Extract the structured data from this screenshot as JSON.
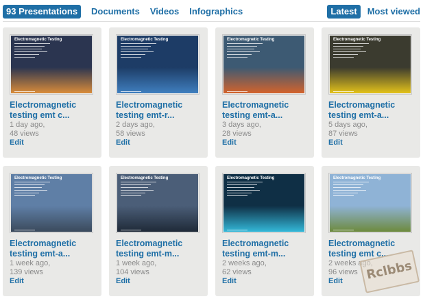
{
  "tabs": {
    "presentations_label": "93 Presentations",
    "documents_label": "Documents",
    "videos_label": "Videos",
    "infographics_label": "Infographics"
  },
  "sort": {
    "latest_label": "Latest",
    "most_viewed_label": "Most viewed"
  },
  "cards": [
    {
      "title_line1": "Electromagnetic",
      "title_line2": "testing emt c...",
      "age": "1 day ago,",
      "views": "48 views",
      "edit": "Edit",
      "thumb_title": "Electromagnetic Testing",
      "bg": "#2b3550",
      "accent": "#d98c3a"
    },
    {
      "title_line1": "Electromagnetic",
      "title_line2": "testing emt-r...",
      "age": "2 days ago,",
      "views": "58 views",
      "edit": "Edit",
      "thumb_title": "Electromagnetic Testing",
      "bg": "#1d3c66",
      "accent": "#3f7fbf"
    },
    {
      "title_line1": "Electromagnetic",
      "title_line2": "testing emt-a...",
      "age": "3 days ago,",
      "views": "28 views",
      "edit": "Edit",
      "thumb_title": "Electromagnetic Testing",
      "bg": "#3d5a73",
      "accent": "#d3632c"
    },
    {
      "title_line1": "Electromagnetic",
      "title_line2": "testing emt-a...",
      "age": "5 days ago,",
      "views": "87 views",
      "edit": "Edit",
      "thumb_title": "Electromagnetic Testing",
      "bg": "#3b3b2f",
      "accent": "#e3c21a"
    },
    {
      "title_line1": "Electromagnetic",
      "title_line2": "testing emt-a...",
      "age": "1 week ago,",
      "views": "139 views",
      "edit": "Edit",
      "thumb_title": "Electromagnetic Testing",
      "bg": "#5f7fa6",
      "accent": "#3b4a5c"
    },
    {
      "title_line1": "Electromagnetic",
      "title_line2": "testing emt-m...",
      "age": "1 week ago,",
      "views": "104 views",
      "edit": "Edit",
      "thumb_title": "Electromagnetic Testing",
      "bg": "#4b5e78",
      "accent": "#1f2a38"
    },
    {
      "title_line1": "Electromagnetic",
      "title_line2": "testing emt-m...",
      "age": "2 weeks ago,",
      "views": "62 views",
      "edit": "Edit",
      "thumb_title": "Electromagnetic Testing",
      "bg": "#0f2f45",
      "accent": "#33b8d8"
    },
    {
      "title_line1": "Electromagnetic",
      "title_line2": "testing emt c...",
      "age": "2 weeks ago,",
      "views": "96 views",
      "edit": "Edit",
      "thumb_title": "Electromagnetic Testing",
      "bg": "#8fb3d6",
      "accent": "#6d8a3d"
    }
  ],
  "watermark": "Rclbbs"
}
